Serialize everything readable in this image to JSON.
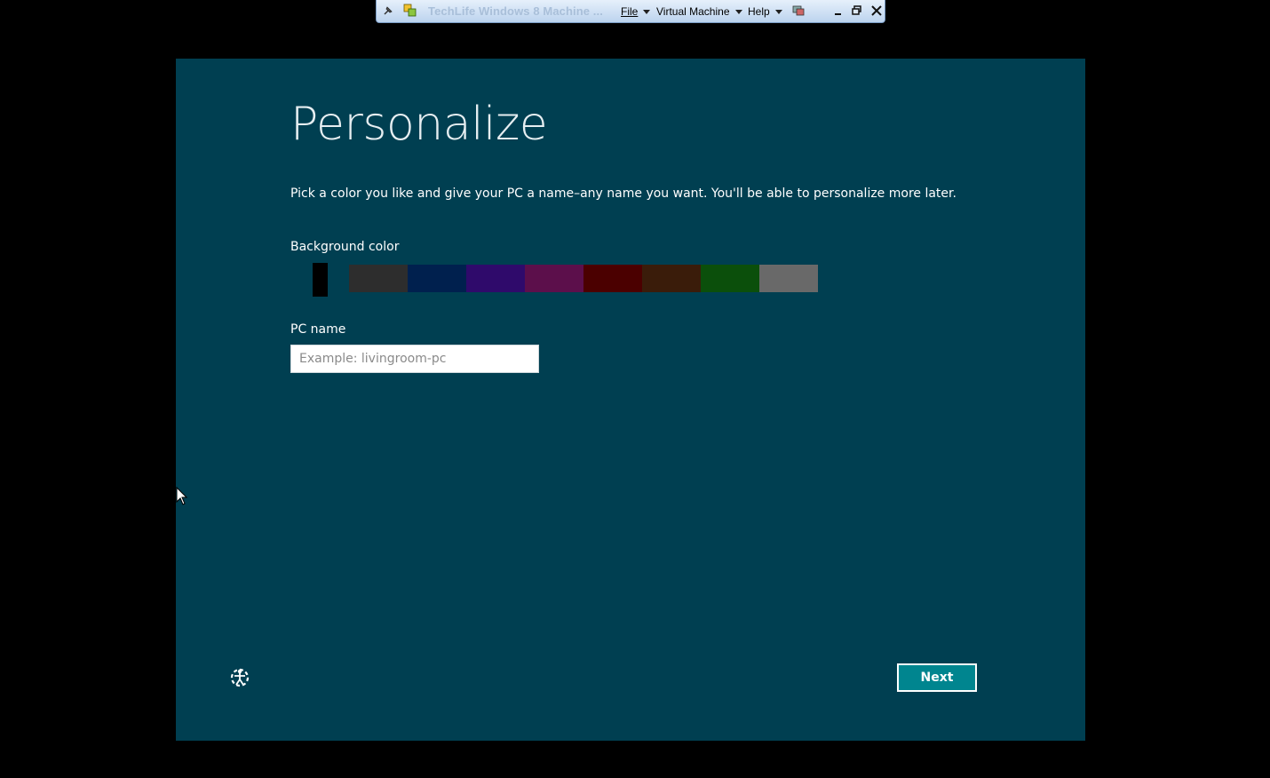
{
  "vm_toolbar": {
    "title": "TechLife Windows 8 Machine ...",
    "menus": [
      "File",
      "Virtual Machine",
      "Help"
    ]
  },
  "page": {
    "title": "Personalize",
    "description": "Pick a color you like and give your PC a name–any name you want. You'll be able to personalize more later.",
    "background_color_label": "Background color",
    "swatches": [
      "#003f51",
      "#2d2d2d",
      "#00204e",
      "#2f0a6b",
      "#5c0f4b",
      "#4b0000",
      "#3a1c0a",
      "#0b4f0b",
      "#696969"
    ],
    "selected_swatch": "#003f51",
    "pc_name_label": "PC name",
    "pc_name_value": "",
    "pc_name_placeholder": "Example: livingroom-pc",
    "next_label": "Next"
  },
  "colors": {
    "screen_bg": "#003f51",
    "next_bg": "#00858f"
  },
  "icons": [
    "pin-icon",
    "vm-logo-icon",
    "ease-of-access-icon",
    "minimize-icon",
    "restore-icon",
    "close-icon",
    "mouse-pointer-icon"
  ]
}
